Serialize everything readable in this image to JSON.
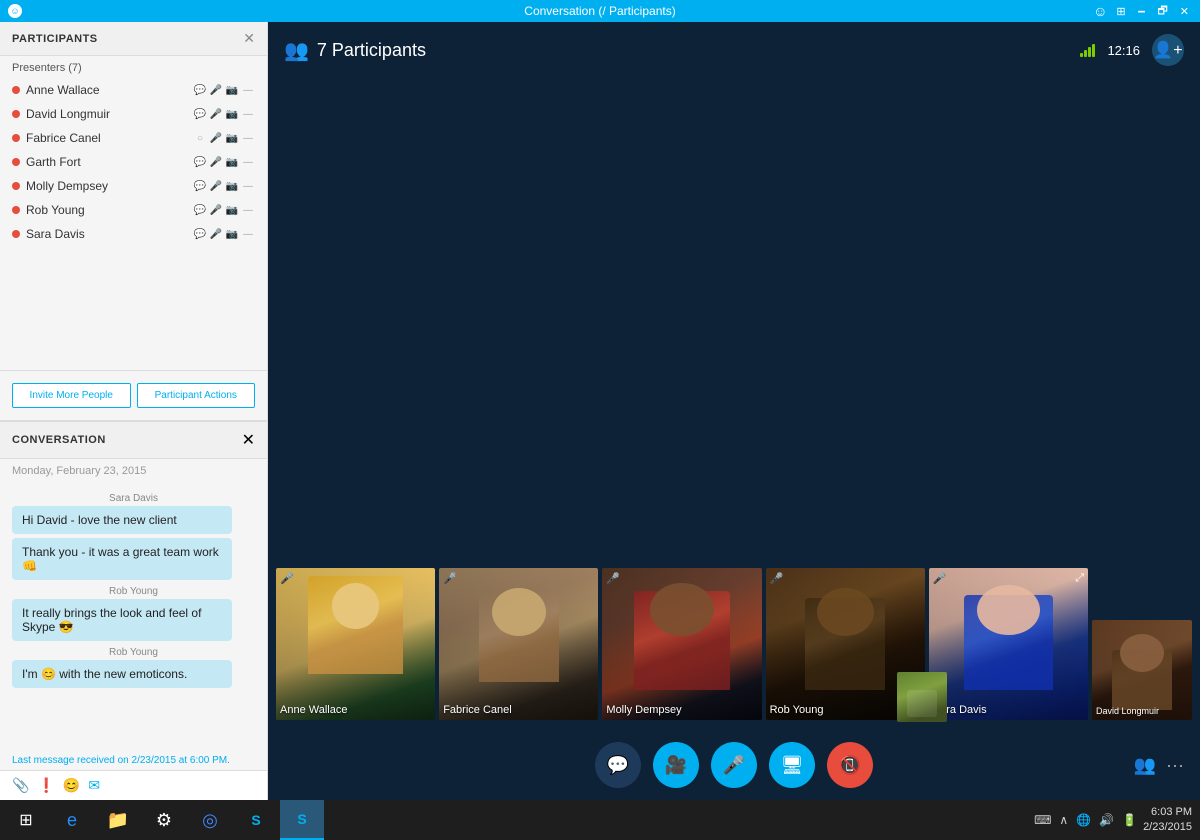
{
  "titleBar": {
    "title": "Conversation (/ Participants)",
    "leftIcon": "☺"
  },
  "leftPanel": {
    "participantsHeader": "PARTICIPANTS",
    "presentersLabel": "Presenters (7)",
    "participants": [
      {
        "name": "Anne Wallace",
        "icons": [
          "💬",
          "🎤",
          "📷",
          "—"
        ]
      },
      {
        "name": "David Longmuir",
        "icons": [
          "💬",
          "🎤",
          "📷",
          "—"
        ]
      },
      {
        "name": "Fabrice Canel",
        "icons": [
          "○",
          "🎤",
          "📷",
          "—"
        ]
      },
      {
        "name": "Garth Fort",
        "icons": [
          "💬",
          "🎤",
          "📷",
          "—"
        ]
      },
      {
        "name": "Molly Dempsey",
        "icons": [
          "💬",
          "🎤",
          "📷",
          "—"
        ]
      },
      {
        "name": "Rob Young",
        "icons": [
          "💬",
          "🎤",
          "📷",
          "—"
        ]
      },
      {
        "name": "Sara Davis",
        "icons": [
          "💬",
          "🎤",
          "📷",
          "—"
        ]
      }
    ],
    "inviteBtn": "Invite More People",
    "actionsBtn": "Participant Actions",
    "conversationHeader": "CONVERSATION",
    "chatDate": "Monday, February 23, 2015",
    "messages": [
      {
        "sender": "Sara Davis",
        "text": "Hi David - love the new client"
      },
      {
        "sender": "",
        "text": "Thank you - it was a great team work 👊"
      },
      {
        "sender": "Rob Young",
        "text": "It really brings the look and feel of Skype 😎"
      },
      {
        "sender": "Rob Young",
        "text": "I'm 😊 with the new emoticons."
      }
    ],
    "lastMessageInfo": "Last message received on 2/23/2015 at 6:00 PM."
  },
  "rightPanel": {
    "participantsCount": "7 Participants",
    "time": "12:16",
    "videoTiles": [
      {
        "name": "Anne Wallace",
        "personClass": "person-anne"
      },
      {
        "name": "Fabrice Canel",
        "personClass": "person-fabrice"
      },
      {
        "name": "Molly Dempsey",
        "personClass": "person-molly"
      },
      {
        "name": "Rob Young",
        "personClass": "person-rob"
      },
      {
        "name": "Sara Davis",
        "personClass": "person-sara"
      },
      {
        "name": "David Longmuir",
        "personClass": "person-david-small",
        "small": true
      }
    ]
  },
  "taskbar": {
    "time": "6:03 PM",
    "date": "2/23/2015"
  }
}
